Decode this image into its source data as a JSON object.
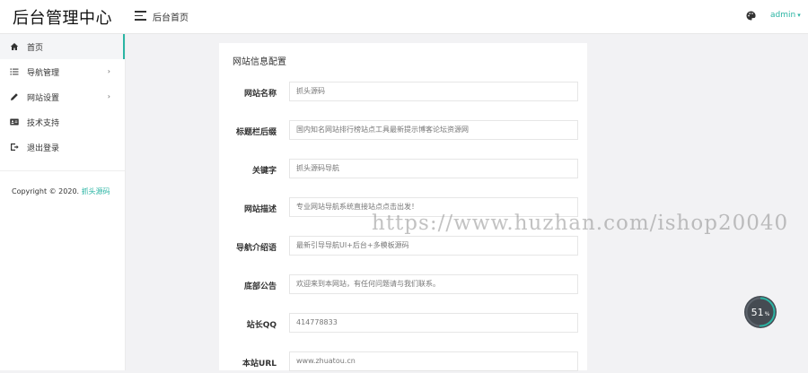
{
  "header": {
    "logo": "后台管理中心",
    "title": "后台首页",
    "user": "admin",
    "user_caret": "▾"
  },
  "sidebar": {
    "items": [
      {
        "label": "首页",
        "icon": "home-icon",
        "has_arrow": false,
        "active": true
      },
      {
        "label": "导航管理",
        "icon": "list-icon",
        "has_arrow": true,
        "arrow": "›"
      },
      {
        "label": "网站设置",
        "icon": "pencil-icon",
        "has_arrow": true,
        "arrow": "›"
      },
      {
        "label": "技术支持",
        "icon": "id-card-icon",
        "has_arrow": false
      },
      {
        "label": "退出登录",
        "icon": "logout-icon",
        "has_arrow": false
      }
    ],
    "copyright_prefix": "Copyright © 2020.",
    "copyright_brand": "抓头源码"
  },
  "form": {
    "title": "网站信息配置",
    "fields": [
      {
        "label": "网站名称",
        "value": "抓头源码"
      },
      {
        "label": "标题栏后缀",
        "value": "国内知名网站排行榜站点工具最新提示博客论坛资源网"
      },
      {
        "label": "关键字",
        "value": "抓头源码导航"
      },
      {
        "label": "网站描述",
        "value": "专业网站导航系统直接站点点击出发！"
      },
      {
        "label": "导航介绍语",
        "value": "最新引导导航UI+后台+多模板源码"
      },
      {
        "label": "底部公告",
        "value": "欢迎来到本网站，有任何问题请与我们联系。"
      },
      {
        "label": "站长QQ",
        "value": "414778833"
      },
      {
        "label": "本站URL",
        "value": "www.zhuatou.cn"
      }
    ]
  },
  "watermark": "https://www.huzhan.com/ishop20040",
  "gauge": {
    "value": "51",
    "unit": "%",
    "progress": 0.51
  },
  "colors": {
    "accent": "#2bb5a4",
    "gauge_bg": "#454b52",
    "gauge_ring": "#2bb5a4"
  }
}
